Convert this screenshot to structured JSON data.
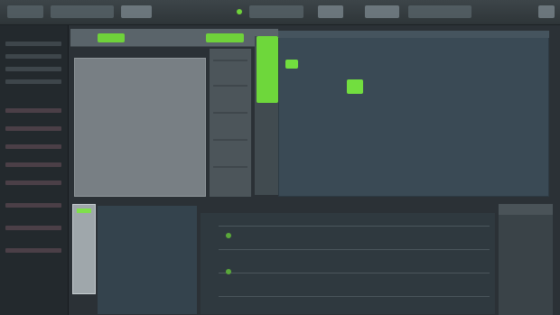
{
  "app": {
    "accent": "#6fd23a",
    "background": "#2b3136"
  },
  "toolbar": {
    "segments": [
      "",
      "",
      "",
      "",
      "",
      ""
    ]
  },
  "browser": {
    "items": [
      "",
      "",
      "",
      "",
      "",
      "",
      "",
      "",
      "",
      "",
      "",
      ""
    ]
  },
  "channel_rack": {
    "header_label": ""
  },
  "playlist": {
    "label": ""
  },
  "mixer": {
    "label": ""
  },
  "icons": [
    "play-icon",
    "stop-icon",
    "record-icon"
  ]
}
